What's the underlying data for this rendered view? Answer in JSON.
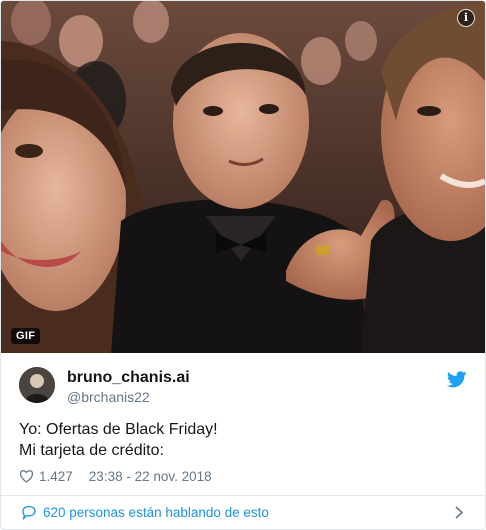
{
  "media": {
    "badge": "GIF",
    "info_icon": "info-icon",
    "info_glyph": "i"
  },
  "user": {
    "display_name": "bruno_chanis.ai",
    "handle": "@brchanis22"
  },
  "tweet": {
    "text": "Yo: Ofertas de Black Friday!\nMi tarjeta de crédito:"
  },
  "stats": {
    "likes": "1.427",
    "timestamp": "23:38 - 22 nov. 2018"
  },
  "footer": {
    "conversation": "620 personas están hablando de esto"
  },
  "colors": {
    "twitter_blue": "#1da1f2",
    "link_blue": "#1b95e0",
    "muted": "#657786",
    "border": "#e1e8ed"
  }
}
